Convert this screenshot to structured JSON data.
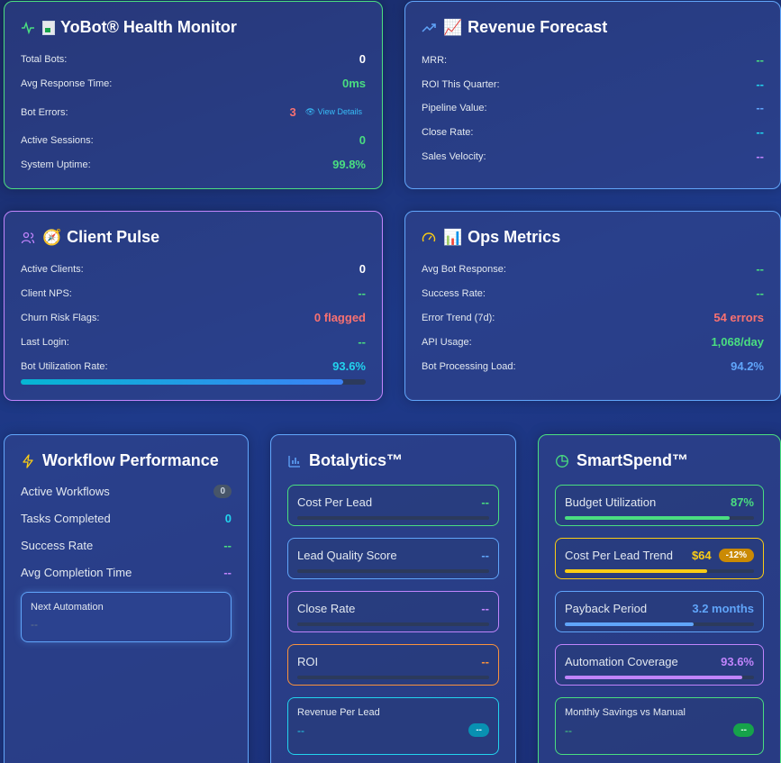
{
  "health": {
    "title": "YoBot® Health Monitor",
    "icon": "activity-icon",
    "rows": [
      {
        "label": "Total Bots:",
        "value": "0"
      },
      {
        "label": "Avg Response Time:",
        "value": "0ms"
      },
      {
        "label": "Bot Errors:",
        "value": "3",
        "link": "👁 View Details"
      },
      {
        "label": "Active Sessions:",
        "value": "0"
      },
      {
        "label": "System Uptime:",
        "value": "99.8%"
      }
    ]
  },
  "revenue": {
    "title": "Revenue Forecast",
    "emoji": "📈",
    "rows": [
      {
        "label": "MRR:",
        "value": "--"
      },
      {
        "label": "ROI This Quarter:",
        "value": "--"
      },
      {
        "label": "Pipeline Value:",
        "value": "--"
      },
      {
        "label": "Close Rate:",
        "value": "--"
      },
      {
        "label": "Sales Velocity:",
        "value": "--"
      }
    ]
  },
  "pulse": {
    "title": "Client Pulse",
    "emoji": "🧭",
    "rows": [
      {
        "label": "Active Clients:",
        "value": "0"
      },
      {
        "label": "Client NPS:",
        "value": "--"
      },
      {
        "label": "Churn Risk Flags:",
        "value": "0 flagged"
      },
      {
        "label": "Last Login:",
        "value": "--"
      },
      {
        "label": "Bot Utilization Rate:",
        "value": "93.6%"
      }
    ],
    "utilization_fraction": 0.936
  },
  "ops": {
    "title": "Ops Metrics",
    "emoji": "📊",
    "rows": [
      {
        "label": "Avg Bot Response:",
        "value": "--"
      },
      {
        "label": "Success Rate:",
        "value": "--"
      },
      {
        "label": "Error Trend (7d):",
        "value": "54 errors"
      },
      {
        "label": "API Usage:",
        "value": "1,068/day"
      },
      {
        "label": "Bot Processing Load:",
        "value": "94.2%"
      }
    ]
  },
  "workflow": {
    "title": "Workflow Performance",
    "rows": [
      {
        "label": "Active Workflows",
        "value": "0"
      },
      {
        "label": "Tasks Completed",
        "value": "0"
      },
      {
        "label": "Success Rate",
        "value": "--"
      },
      {
        "label": "Avg Completion Time",
        "value": "--"
      }
    ],
    "next": {
      "label": "Next Automation",
      "value": "--"
    }
  },
  "botalytics": {
    "title": "Botalytics™",
    "tiles": [
      {
        "label": "Cost Per Lead",
        "value": "--",
        "color": "#4ade80"
      },
      {
        "label": "Lead Quality Score",
        "value": "--",
        "color": "#60a5fa"
      },
      {
        "label": "Close Rate",
        "value": "--",
        "color": "#c084fc"
      },
      {
        "label": "ROI",
        "value": "--",
        "color": "#fb923c"
      },
      {
        "label": "Revenue Per Lead",
        "value": "--",
        "chip": "--",
        "color": "#22d3ee"
      }
    ]
  },
  "smartspend": {
    "title": "SmartSpend™",
    "tiles": [
      {
        "label": "Budget Utilization",
        "value": "87%",
        "fraction": 0.87,
        "color": "#4ade80"
      },
      {
        "label": "Cost Per Lead Trend",
        "value": "$64",
        "chip": "-12%",
        "fraction": 0.75,
        "color": "#facc15"
      },
      {
        "label": "Payback Period",
        "value": "3.2 months",
        "fraction": 0.68,
        "color": "#60a5fa"
      },
      {
        "label": "Automation Coverage",
        "value": "93.6%",
        "fraction": 0.936,
        "color": "#c084fc"
      },
      {
        "label": "Monthly Savings vs Manual",
        "value": "--",
        "chip": "--",
        "color": "#4ade80"
      }
    ]
  }
}
